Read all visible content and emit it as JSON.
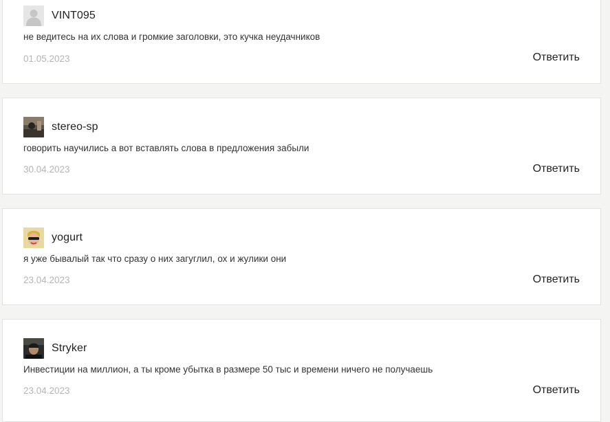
{
  "comments": [
    {
      "author": "VINT095",
      "avatar": "default-user-icon",
      "text": "не ведитесь на их слова и громкие заголовки, это кучка неудачников",
      "date": "01.05.2023",
      "reply_label": "Ответить"
    },
    {
      "author": "stereo-sp",
      "avatar": "user-photo-avatar",
      "text": "говорить научились а вот вставлять слова в предложения забыли",
      "date": "30.04.2023",
      "reply_label": "Ответить"
    },
    {
      "author": "yogurt",
      "avatar": "user-photo-avatar",
      "text": "я уже бывалый так что сразу о них загуглил, ох и жулики они",
      "date": "23.04.2023",
      "reply_label": "Ответить"
    },
    {
      "author": "Stryker",
      "avatar": "user-photo-avatar",
      "text": "Инвестиции на миллион, а ты кроме убытка в размере 50 тыс и времени ничего не получаешь",
      "date": "23.04.2023",
      "reply_label": "Ответить"
    }
  ],
  "colors": {
    "page_background": "#f4f4f2",
    "card_background": "#ffffff",
    "card_border": "#e3e3e3",
    "text": "#333333",
    "date": "#b5b5b5"
  }
}
